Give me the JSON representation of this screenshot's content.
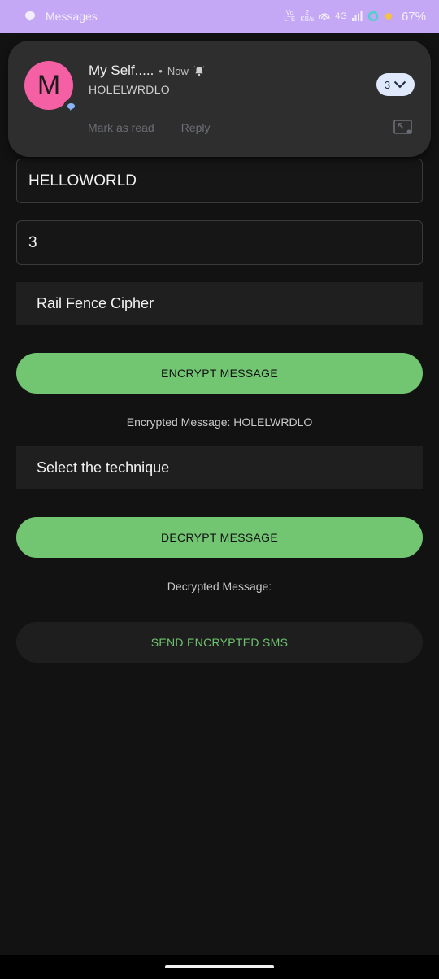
{
  "status_bar": {
    "app_name": "Messages",
    "network_top": "Vo",
    "network_bottom": "LTE",
    "speed_value": "2",
    "speed_unit": "KB/s",
    "network_type": "4G",
    "battery": "67%",
    "background_color": "#c5a8f5"
  },
  "notification": {
    "avatar_letter": "M",
    "avatar_color": "#f560a5",
    "title": "My Self.....",
    "time": "Now",
    "body": "HOLELWRDLO",
    "count": "3",
    "actions": [
      "Mark as read",
      "Reply"
    ]
  },
  "form": {
    "message_value": "HELLOWORLD",
    "key_value": "3",
    "encrypt_technique": "Rail Fence Cipher",
    "encrypt_button": "ENCRYPT MESSAGE",
    "encrypted_result": "Encrypted Message: HOLELWRDLO",
    "decrypt_technique": "Select the technique",
    "decrypt_button": "DECRYPT MESSAGE",
    "decrypted_result": "Decrypted Message:",
    "send_button": "SEND ENCRYPTED SMS"
  },
  "colors": {
    "accent_green": "#72c672",
    "background": "#121212",
    "surface": "#1f1f1f"
  }
}
